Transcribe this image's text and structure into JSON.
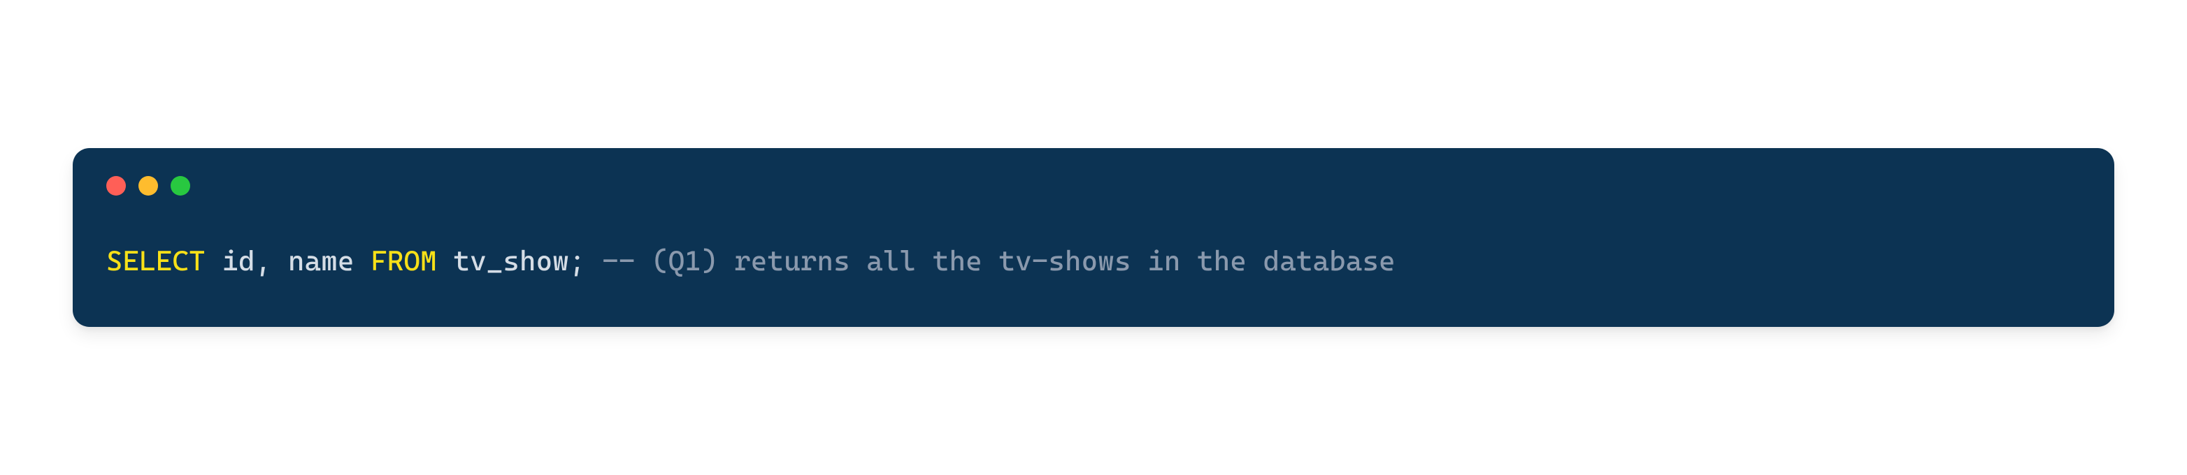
{
  "code": {
    "tokens": {
      "kw_select": "SELECT",
      "sp1": " ",
      "id1": "id",
      "comma": ",",
      "sp2": " ",
      "id2": "name",
      "sp3": " ",
      "kw_from": "FROM",
      "sp4": " ",
      "id3": "tv_show",
      "semi": ";",
      "sp5": " ",
      "comment": "-- (Q1) returns all the tv-shows in the database"
    }
  },
  "window": {
    "traffic_lights": {
      "red": "close",
      "yellow": "minimize",
      "green": "maximize"
    }
  }
}
